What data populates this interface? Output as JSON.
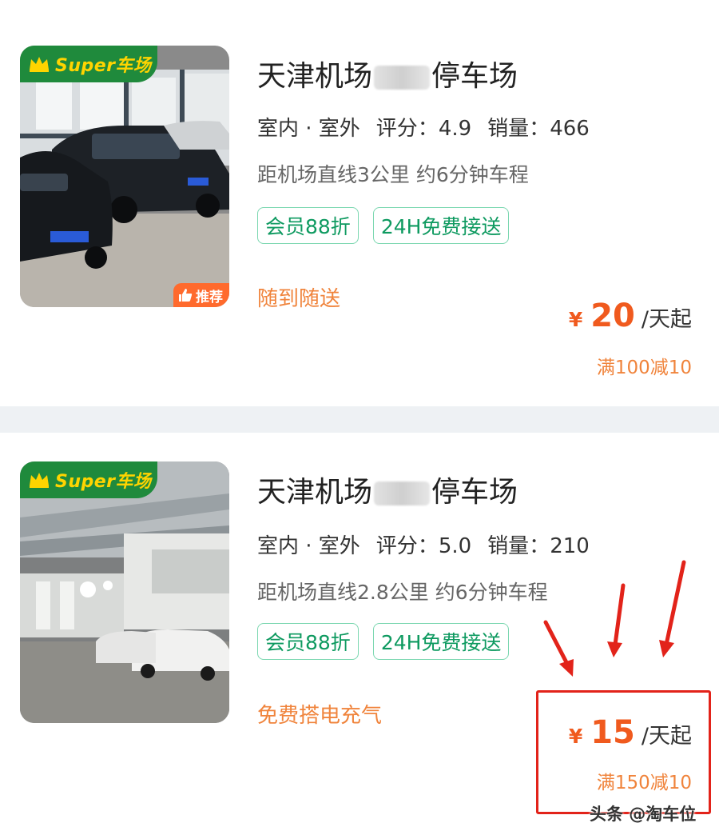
{
  "listings": [
    {
      "badge": "Super车场",
      "recommend": "推荐",
      "title_prefix": "天津机场",
      "title_suffix": "停车场",
      "environment": "室内 · 室外",
      "rating_label": "评分：",
      "rating": "4.9",
      "sales_label": "销量：",
      "sales": "466",
      "distance": "距机场直线3公里 约6分钟车程",
      "tags": [
        "会员88折",
        "24H免费接送"
      ],
      "perk": "随到随送",
      "currency": "¥",
      "price": "20",
      "price_unit": "/天起",
      "discount": "满100减10"
    },
    {
      "badge": "Super车场",
      "title_prefix": "天津机场",
      "title_suffix": "停车场",
      "environment": "室内 · 室外",
      "rating_label": "评分：",
      "rating": "5.0",
      "sales_label": "销量：",
      "sales": "210",
      "distance": "距机场直线2.8公里 约6分钟车程",
      "tags": [
        "会员88折",
        "24H免费接送"
      ],
      "perk": "免费搭电充气",
      "currency": "¥",
      "price": "15",
      "price_unit": "/天起",
      "discount": "满150减10"
    }
  ],
  "watermark": "头条 @淘车位",
  "colors": {
    "accent_green": "#1f8a3c",
    "badge_yellow": "#ffd400",
    "tag_green": "#0e9a60",
    "price_orange": "#f05a1e",
    "annotation_red": "#e2231a"
  },
  "icons": [
    "crown-icon",
    "thumbs-up-icon",
    "red-arrow-icon"
  ]
}
